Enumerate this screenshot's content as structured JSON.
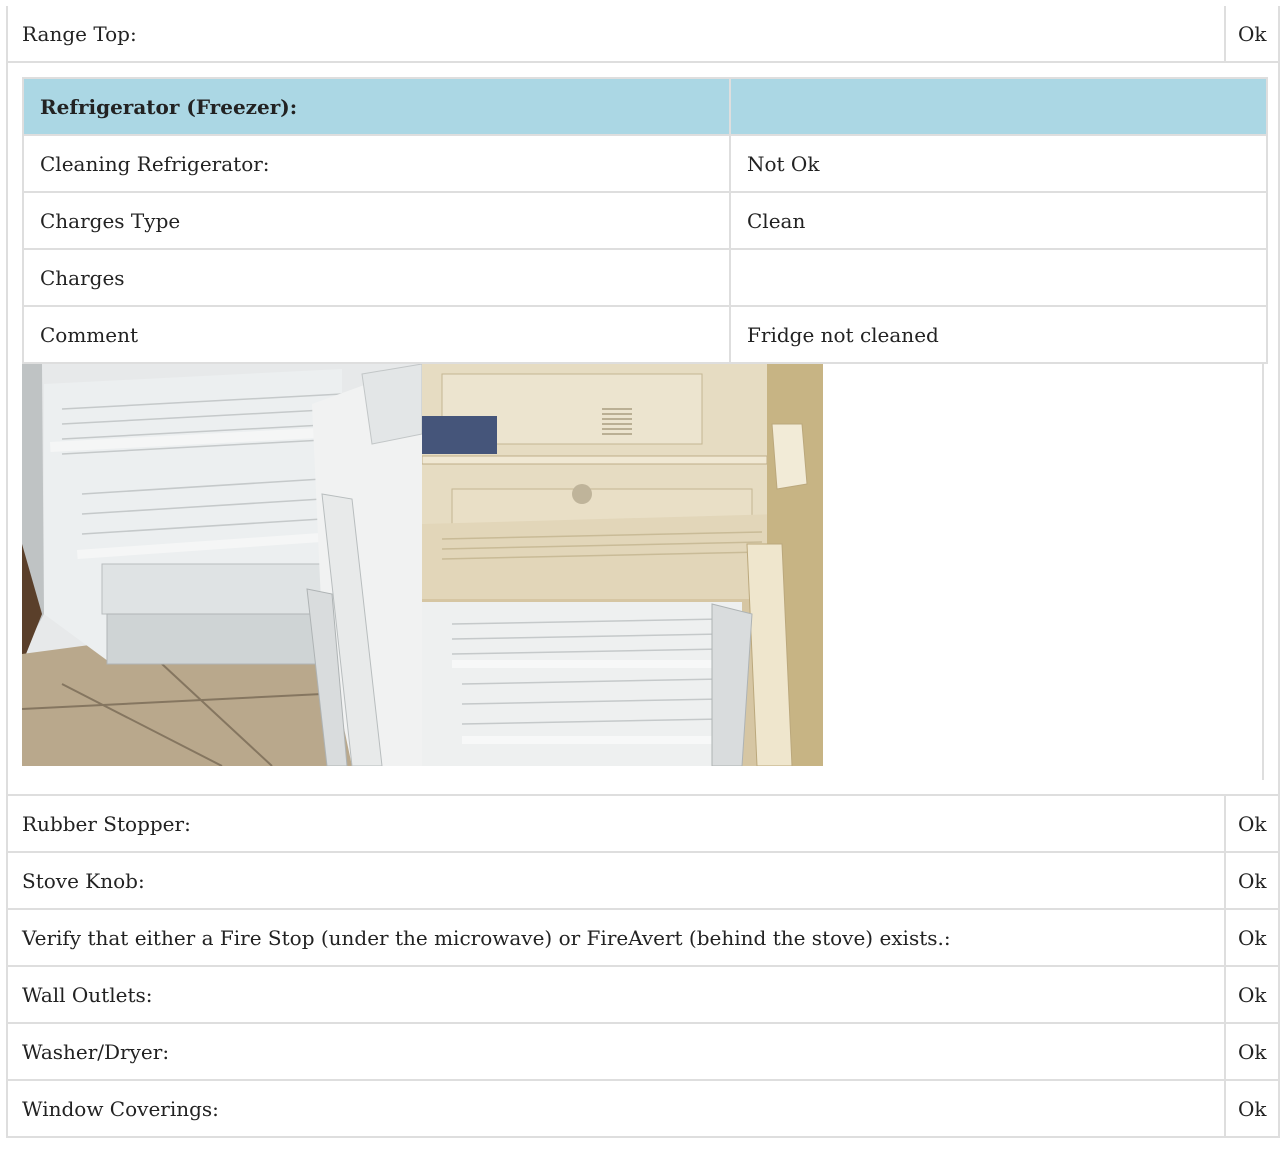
{
  "rows_before": [
    {
      "label": "Range Top:",
      "value": "Ok"
    }
  ],
  "refrigerator": {
    "title": "Refrigerator (Freezer):",
    "title_value": "",
    "rows": [
      {
        "label": "Cleaning Refrigerator:",
        "value": "Not Ok"
      },
      {
        "label": "Charges Type",
        "value": "Clean"
      },
      {
        "label": "Charges",
        "value": ""
      },
      {
        "label": "Comment",
        "value": "Fridge not cleaned"
      }
    ],
    "header_color": "#abd7e4"
  },
  "rows_after": [
    {
      "label": "Rubber Stopper:",
      "value": "Ok"
    },
    {
      "label": "Stove Knob:",
      "value": "Ok"
    },
    {
      "label": "Verify that either a Fire Stop (under the microwave) or FireAvert (behind the stove) exists.:",
      "value": "Ok"
    },
    {
      "label": "Wall Outlets:",
      "value": "Ok"
    },
    {
      "label": "Washer/Dryer:",
      "value": "Ok"
    },
    {
      "label": "Window Coverings:",
      "value": "Ok"
    }
  ]
}
